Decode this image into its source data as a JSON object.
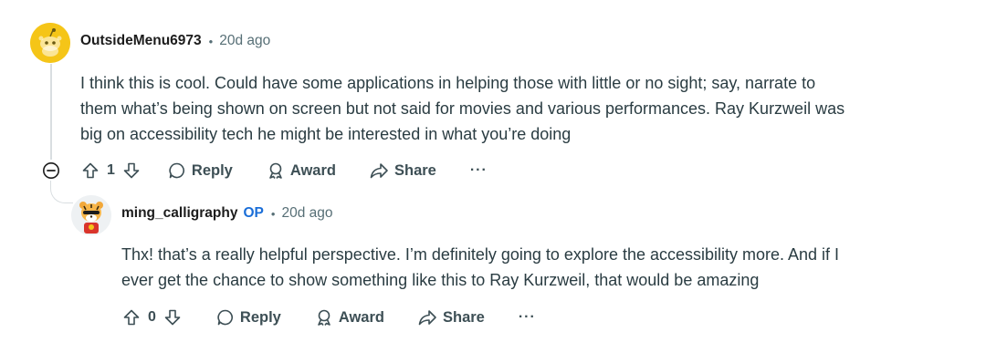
{
  "comments": [
    {
      "author": "OutsideMenu6973",
      "separator": "•",
      "time": "20d ago",
      "lines": [
        "I think this is cool. Could have some applications in helping those with little or no sight; say, narrate to",
        "them what’s being shown on screen but not said for movies and various performances. Ray Kurzweil was",
        "big on accessibility tech he might be interested in what you’re doing"
      ],
      "votes": "1",
      "reply_label": "Reply",
      "award_label": "Award",
      "share_label": "Share",
      "more_label": "···",
      "avatar_icon": "snoo-avatar-icon",
      "avatar_color": "#f5c518"
    },
    {
      "author": "ming_calligraphy",
      "op_badge": "OP",
      "separator": "•",
      "time": "20d ago",
      "lines": [
        "Thx! that’s a really helpful perspective. I’m definitely going to explore the accessibility more. And if I",
        "ever get the chance to show something like this to Ray Kurzweil, that would be amazing"
      ],
      "votes": "0",
      "reply_label": "Reply",
      "award_label": "Award",
      "share_label": "Share",
      "more_label": "···",
      "avatar_icon": "tiger-avatar-icon"
    }
  ],
  "collapse_icon": "collapse-thread-icon",
  "colors": {
    "op_badge": "#1a6ed8",
    "meta_gray": "#576f76",
    "thread_line": "#d9dee1"
  }
}
